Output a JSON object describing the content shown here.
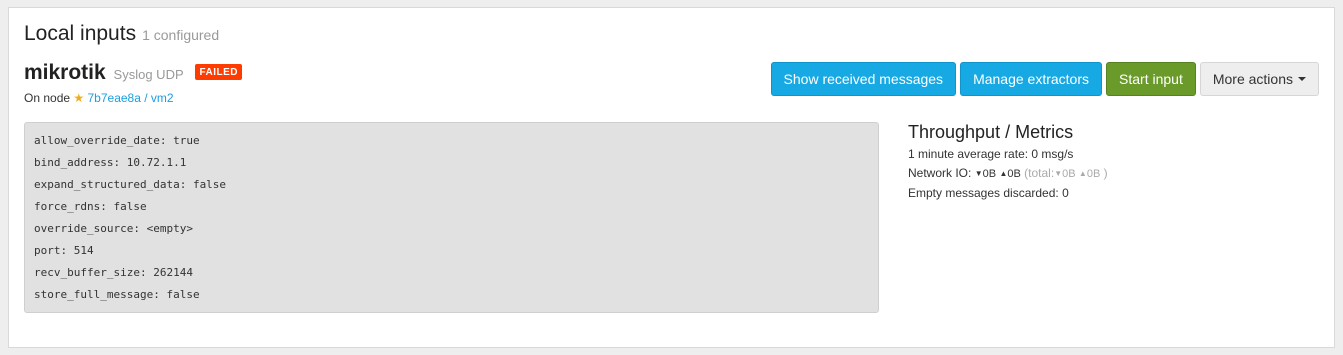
{
  "section": {
    "title": "Local inputs",
    "count": "1 configured"
  },
  "input": {
    "name": "mikrotik",
    "type": "Syslog UDP",
    "status": "FAILED",
    "node_label": "On node",
    "node_link": "7b7eae8a / vm2"
  },
  "actions": {
    "show_messages": "Show received messages",
    "manage_extractors": "Manage extractors",
    "start_input": "Start input",
    "more_actions": "More actions"
  },
  "config": [
    "allow_override_date: true",
    "bind_address: 10.72.1.1",
    "expand_structured_data: false",
    "force_rdns: false",
    "override_source: <empty>",
    "port: 514",
    "recv_buffer_size: 262144",
    "store_full_message: false"
  ],
  "metrics": {
    "title": "Throughput / Metrics",
    "avg_rate": "1 minute average rate: 0 msg/s",
    "network_io_label": "Network IO:",
    "io_in": "0B",
    "io_out": "0B",
    "total_label": "(total:",
    "total_in": "0B",
    "total_out": "0B",
    "total_close": ")",
    "discarded": "Empty messages discarded: 0"
  },
  "colors": {
    "info": "#16a9e4",
    "success": "#6a9b2a",
    "danger": "#ff3b00",
    "link": "#1aa0e0",
    "star": "#f0ad1a"
  },
  "icons": [
    "star-icon",
    "arrow-down-icon",
    "arrow-up-icon",
    "caret-down-icon"
  ]
}
